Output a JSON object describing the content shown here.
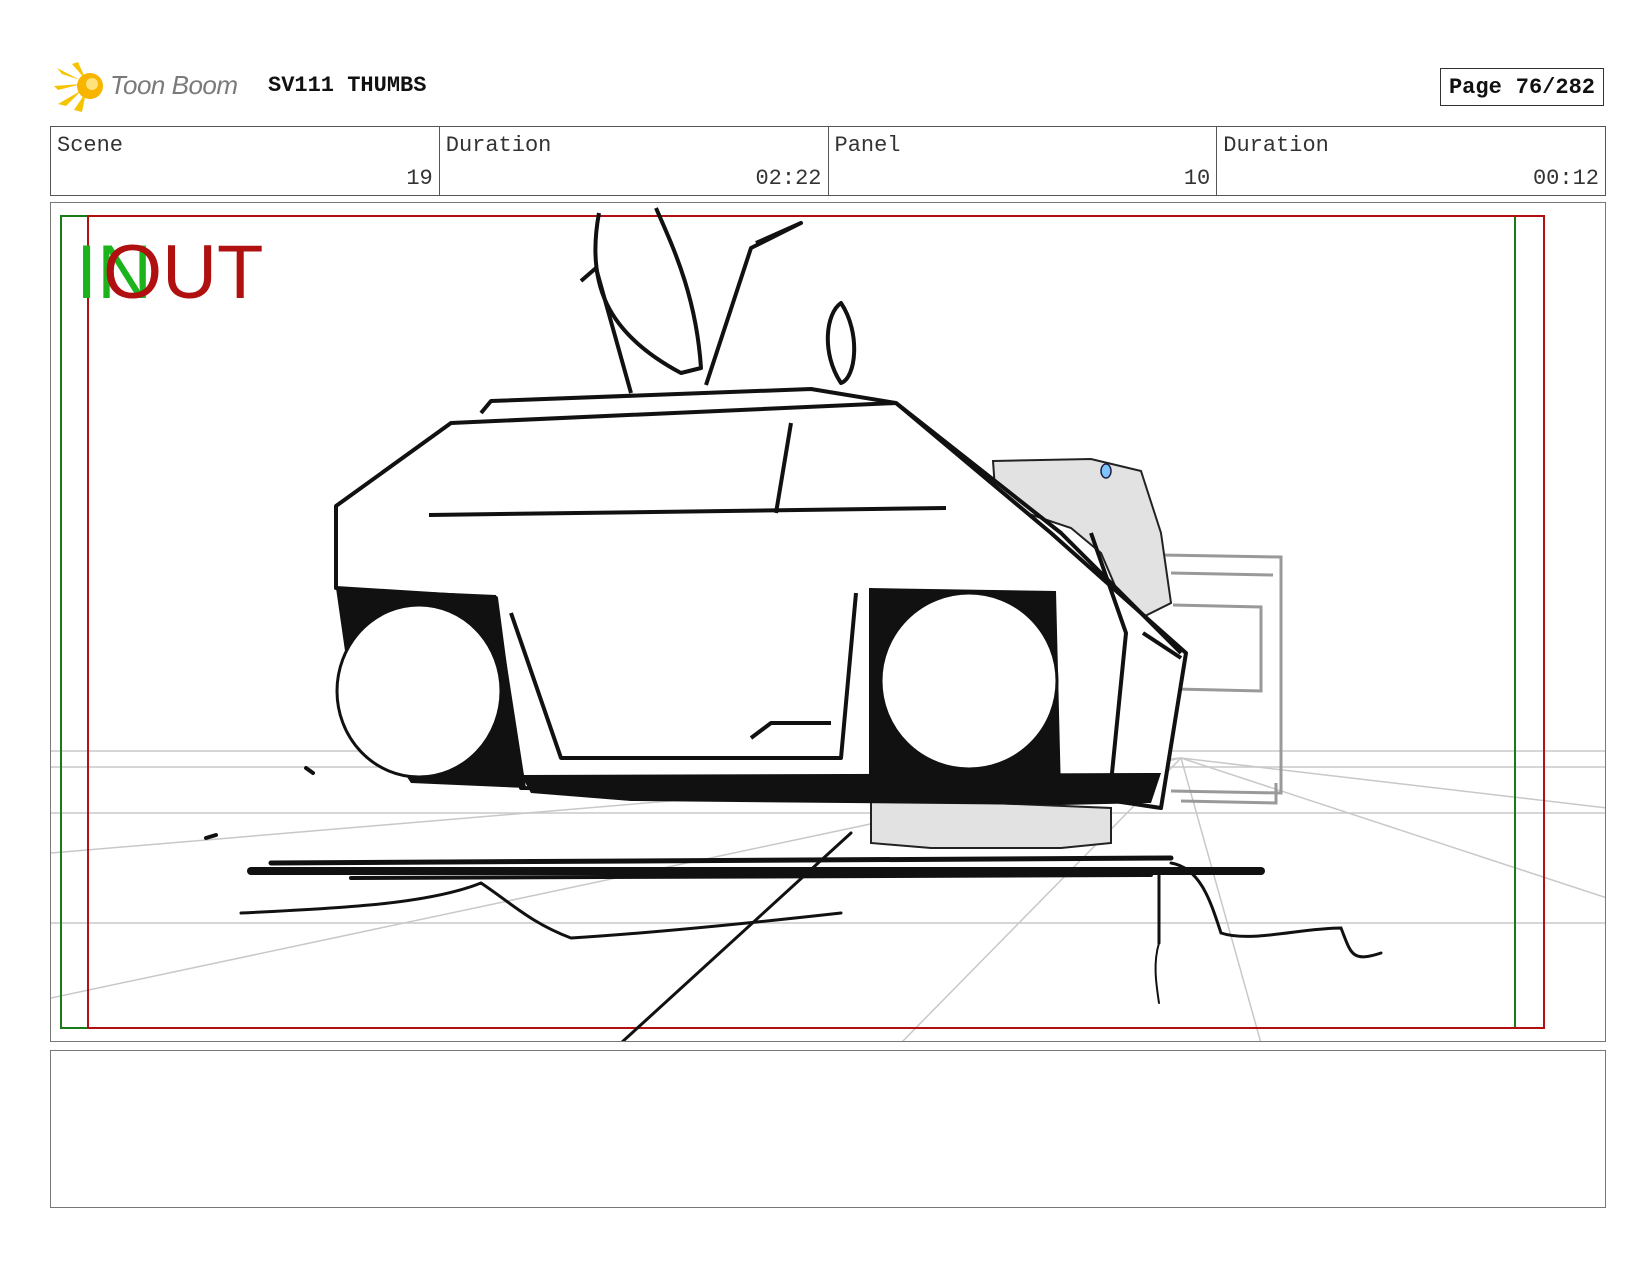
{
  "header": {
    "logo_text": "Toon Boom",
    "doc_title": "SV111 THUMBS",
    "page_label": "Page",
    "page_value": "76/282"
  },
  "info": {
    "scene_label": "Scene",
    "scene_value": "19",
    "scene_duration_label": "Duration",
    "scene_duration_value": "02:22",
    "panel_label": "Panel",
    "panel_value": "10",
    "panel_duration_label": "Duration",
    "panel_duration_value": "00:12"
  },
  "panel": {
    "in_label": "IN",
    "out_label": "OUT",
    "in_color": "#1db31d",
    "out_color": "#b01010"
  },
  "notes": {
    "text": ""
  },
  "colors": {
    "logo_yellow": "#f5c400",
    "frame_green": "#1a7a1a",
    "frame_red": "#b01010"
  }
}
